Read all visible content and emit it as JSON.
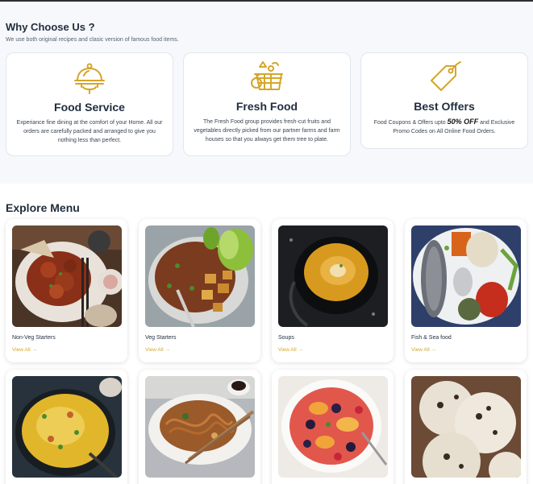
{
  "why_section": {
    "title": "Why Choose Us ?",
    "subtitle": "We use both original recipes and clasic version of famous food items."
  },
  "features": [
    {
      "icon": "cloche-icon",
      "title": "Food Service",
      "desc": "Experiance fine dining at the comfort of your Home. All our orders are carefully packed and arranged to give you nothing less than perfect."
    },
    {
      "icon": "basket-icon",
      "title": "Fresh Food",
      "desc": "The Fresh Food group provides fresh-cut fruits and vegetables directly picked from our partner farms and farm houses so that you always get them tree to plate."
    },
    {
      "icon": "tag-icon",
      "title": "Best Offers",
      "desc_before": "Food Coupons & Offers upto ",
      "highlight": "50% OFF",
      "desc_after": " and Exclusive Promo Codes on All Online Food Orders."
    }
  ],
  "menu": {
    "title": "Explore Menu",
    "categories": [
      {
        "name": "Non-Veg Starters",
        "link": "View All →"
      },
      {
        "name": "Veg Starters",
        "link": "View All →"
      },
      {
        "name": "Soups",
        "link": "View All →"
      },
      {
        "name": "Fish & Sea food",
        "link": "View All →"
      },
      {
        "name": "",
        "link": ""
      },
      {
        "name": "",
        "link": ""
      },
      {
        "name": "",
        "link": ""
      },
      {
        "name": "",
        "link": ""
      }
    ]
  },
  "colors": {
    "accent": "#d4a62a",
    "heading": "#1f2d3d",
    "section_bg": "#f6f8fc"
  }
}
